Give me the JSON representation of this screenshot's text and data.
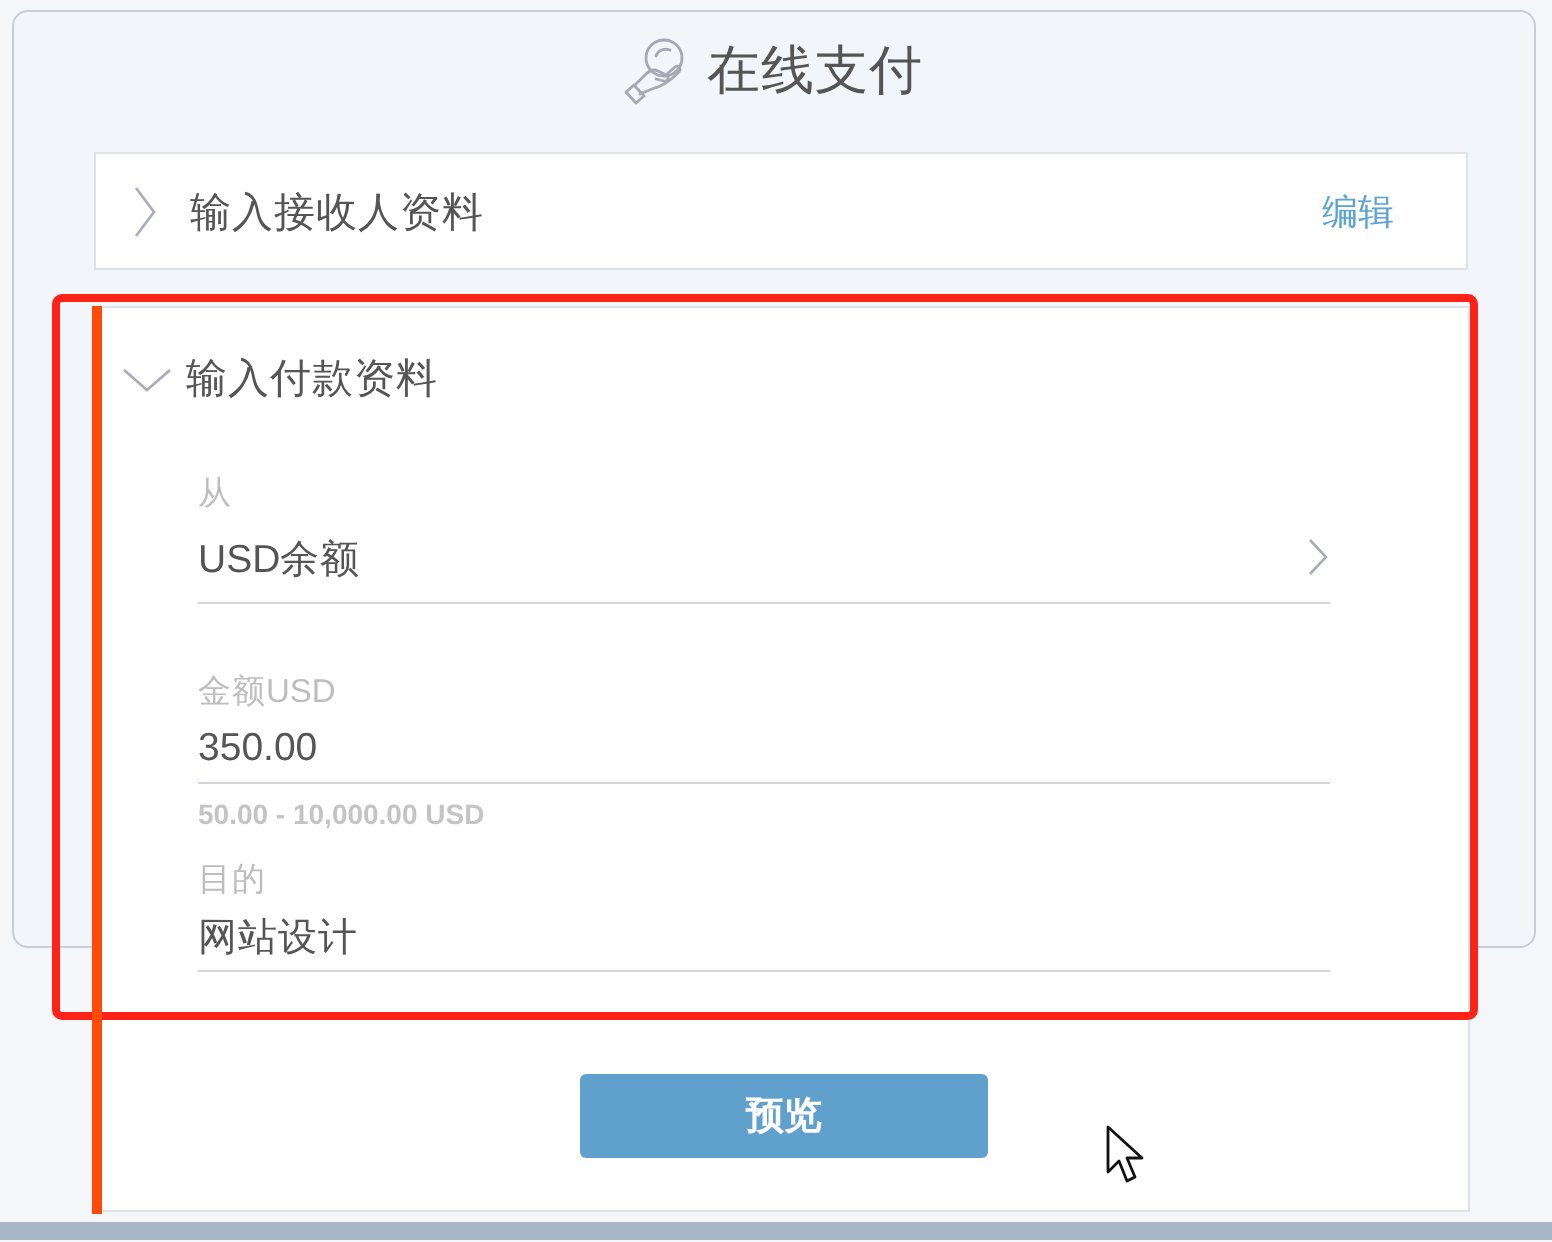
{
  "header": {
    "title": "在线支付"
  },
  "sections": [
    {
      "title": "输入接收人资料",
      "expanded": false,
      "action": "编辑"
    },
    {
      "title": "输入付款资料",
      "expanded": true,
      "fields": [
        {
          "kind": "select",
          "label": "从",
          "value": "USD余额"
        },
        {
          "kind": "text",
          "label": "金额USD",
          "value": "350.00",
          "hint": "50.00 - 10,000.00 USD"
        },
        {
          "kind": "text",
          "label": "目的",
          "value": "网站设计"
        }
      ],
      "button": "预览"
    }
  ]
}
